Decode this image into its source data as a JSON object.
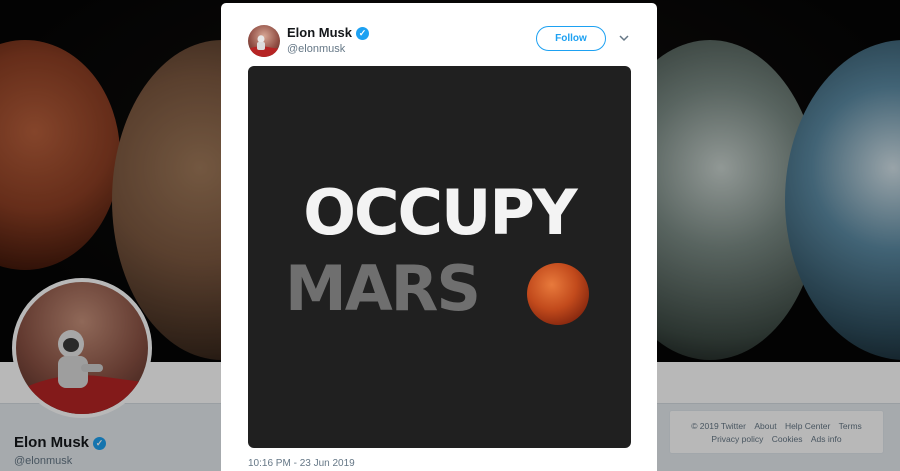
{
  "profile": {
    "name": "Elon Musk",
    "handle": "@elonmusk",
    "verified_icon": "verified-badge-icon"
  },
  "footer": {
    "links_row1": [
      "© 2019 Twitter",
      "About",
      "Help Center",
      "Terms"
    ],
    "links_row2": [
      "Privacy policy",
      "Cookies",
      "Ads info"
    ]
  },
  "tweet": {
    "author_name": "Elon Musk",
    "author_handle": "@elonmusk",
    "follow_label": "Follow",
    "image_text_line1": "OCCUPY",
    "image_text_line2": "MARS",
    "timestamp": "10:16 PM - 23 Jun 2019"
  },
  "colors": {
    "accent": "#1da1f2",
    "text_primary": "#14171a",
    "text_secondary": "#657786",
    "media_bg": "#202020"
  }
}
